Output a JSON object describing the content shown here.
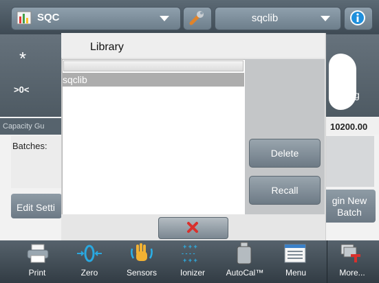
{
  "header": {
    "app_name": "SQC",
    "library_name": "sqclib"
  },
  "main": {
    "star_symbol": "*",
    "zero_indicator": ">0<",
    "unit": "g",
    "capacity_label": "Capacity Gu",
    "capacity_value": "10200.00",
    "batches_label": "Batches:",
    "edit_settings_label": "Edit Setti",
    "begin_new_batch_label": "gin New Batch"
  },
  "dialog": {
    "title": "Library",
    "items": [
      "sqclib"
    ],
    "selected_index": 0,
    "delete_label": "Delete",
    "recall_label": "Recall"
  },
  "toolbar": {
    "items": [
      {
        "label": "Print",
        "icon": "printer-icon"
      },
      {
        "label": "Zero",
        "icon": "zero-icon"
      },
      {
        "label": "Sensors",
        "icon": "sensors-hand-icon"
      },
      {
        "label": "Ionizer",
        "icon": "ionizer-icon"
      },
      {
        "label": "AutoCal™",
        "icon": "autocal-weight-icon"
      },
      {
        "label": "Menu",
        "icon": "menu-icon"
      },
      {
        "label": "More...",
        "icon": "more-icon"
      }
    ]
  },
  "colors": {
    "accent_blue": "#1f8fdc",
    "cancel_red": "#d9302c",
    "dialog_bg": "#e6e6e6"
  }
}
